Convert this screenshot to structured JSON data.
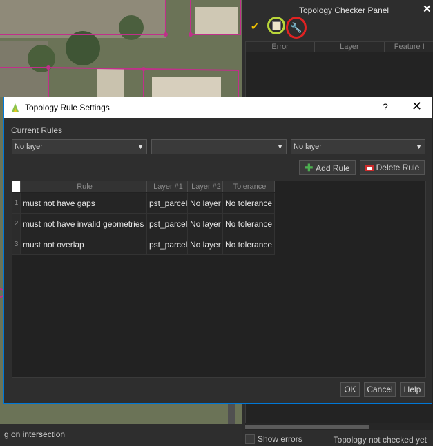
{
  "panel": {
    "title": "Topology Checker Panel",
    "close_icon": "×",
    "columns": [
      "Error",
      "Layer",
      "Feature I"
    ],
    "show_errors_label": "Show errors",
    "status_text": "Topology not checked yet"
  },
  "statusbar": {
    "text": "g on intersection"
  },
  "dialog": {
    "title": "Topology Rule Settings",
    "help_icon": "?",
    "close_icon": "✕",
    "current_rules_label": "Current Rules",
    "combo1": "No layer",
    "combo2": "",
    "combo3": "No layer",
    "add_rule_label": "Add Rule",
    "delete_rule_label": "Delete Rule",
    "table": {
      "headers": [
        "Rule",
        "Layer #1",
        "Layer #2",
        "Tolerance"
      ],
      "rows": [
        {
          "num": "1",
          "rule": "must not have gaps",
          "layer1": "pst_parcel",
          "layer2": "No layer",
          "tolerance": "No tolerance"
        },
        {
          "num": "2",
          "rule": "must not have invalid geometries",
          "layer1": "pst_parcel",
          "layer2": "No layer",
          "tolerance": "No tolerance"
        },
        {
          "num": "3",
          "rule": "must not overlap",
          "layer1": "pst_parcel",
          "layer2": "No layer",
          "tolerance": "No tolerance"
        }
      ]
    },
    "ok_label": "OK",
    "cancel_label": "Cancel",
    "help_label": "Help"
  },
  "colors": {
    "validate_highlight": "#b9d63a",
    "configure_highlight": "#e02222",
    "dialog_border": "#0078d7",
    "parcel_line": "#c0308a"
  }
}
